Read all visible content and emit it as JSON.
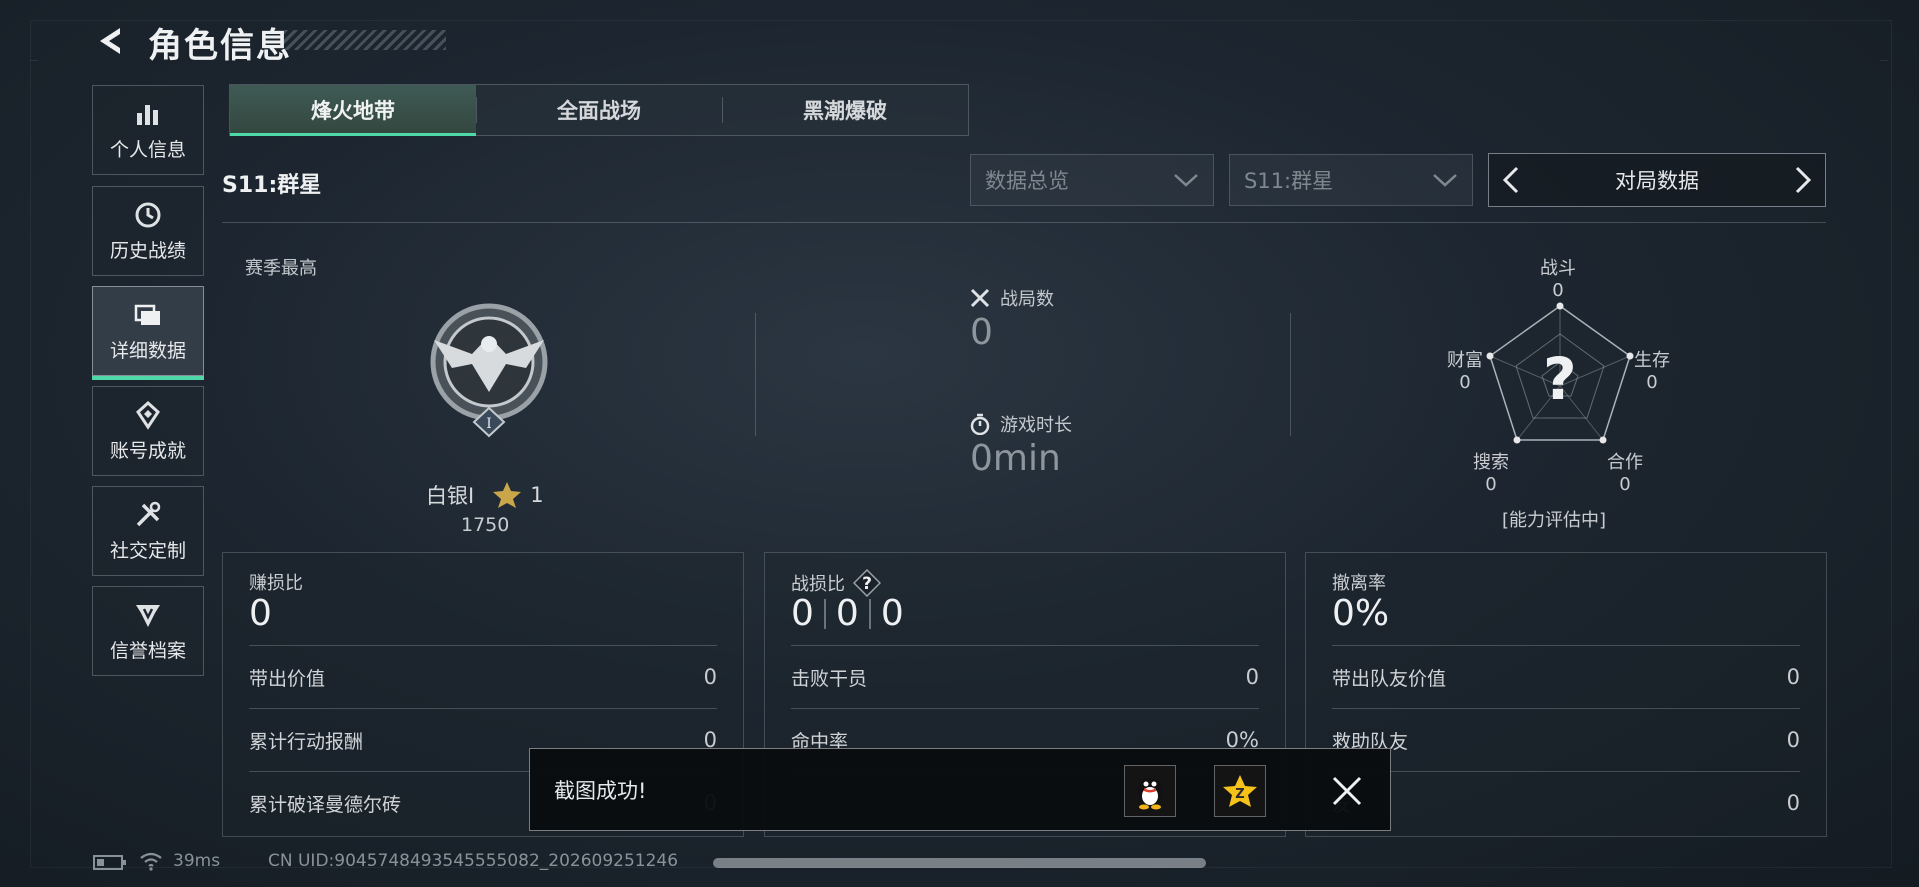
{
  "header": {
    "title": "角色信息"
  },
  "sidebar": {
    "items": [
      {
        "label": "个人信息",
        "icon": "bar-chart-icon"
      },
      {
        "label": "历史战绩",
        "icon": "clock-icon"
      },
      {
        "label": "详细数据",
        "icon": "folder-icon",
        "active": true
      },
      {
        "label": "账号成就",
        "icon": "medal-icon"
      },
      {
        "label": "社交定制",
        "icon": "tools-icon"
      },
      {
        "label": "信誉档案",
        "icon": "shield-badge-icon"
      }
    ]
  },
  "tabs": [
    {
      "label": "烽火地带",
      "active": true
    },
    {
      "label": "全面战场"
    },
    {
      "label": "黑潮爆破"
    }
  ],
  "season": {
    "title": "S11:群星"
  },
  "filters": {
    "overview": "数据总览",
    "season": "S11:群星",
    "nav_label": "对局数据"
  },
  "rank": {
    "section_label": "赛季最高",
    "name": "白银I",
    "stars": "1",
    "score": "1750"
  },
  "summary": {
    "matches_label": "战局数",
    "matches_value": "0",
    "playtime_label": "游戏时长",
    "playtime_value": "0min"
  },
  "radar": {
    "center": "?",
    "status": "[能力评估中]",
    "axes": [
      {
        "label": "战斗",
        "value": "0"
      },
      {
        "label": "生存",
        "value": "0"
      },
      {
        "label": "合作",
        "value": "0"
      },
      {
        "label": "搜索",
        "value": "0"
      },
      {
        "label": "财富",
        "value": "0"
      }
    ]
  },
  "cards": [
    {
      "title": "赚损比",
      "main": "0",
      "rows": [
        {
          "label": "带出价值",
          "value": "0"
        },
        {
          "label": "累计行动报酬",
          "value": "0"
        },
        {
          "label": "累计破译曼德尔砖",
          "value": "0"
        }
      ]
    },
    {
      "title": "战损比",
      "main_parts": [
        "0",
        "0",
        "0"
      ],
      "rows": [
        {
          "label": "击败干员",
          "value": "0"
        },
        {
          "label": "命中率",
          "value": "0%"
        },
        {
          "label": "",
          "value": ""
        }
      ]
    },
    {
      "title": "撤离率",
      "main": "0%",
      "rows": [
        {
          "label": "带出队友价值",
          "value": "0"
        },
        {
          "label": "救助队友",
          "value": "0"
        },
        {
          "label": "友",
          "value": "0"
        }
      ]
    }
  ],
  "toast": {
    "message": "截图成功!"
  },
  "footer": {
    "ping": "39ms",
    "uid": "CN UID:9045748493545555082_202609251246"
  },
  "colors": {
    "accent": "#4fd8a8",
    "gold": "#c9a64a"
  }
}
